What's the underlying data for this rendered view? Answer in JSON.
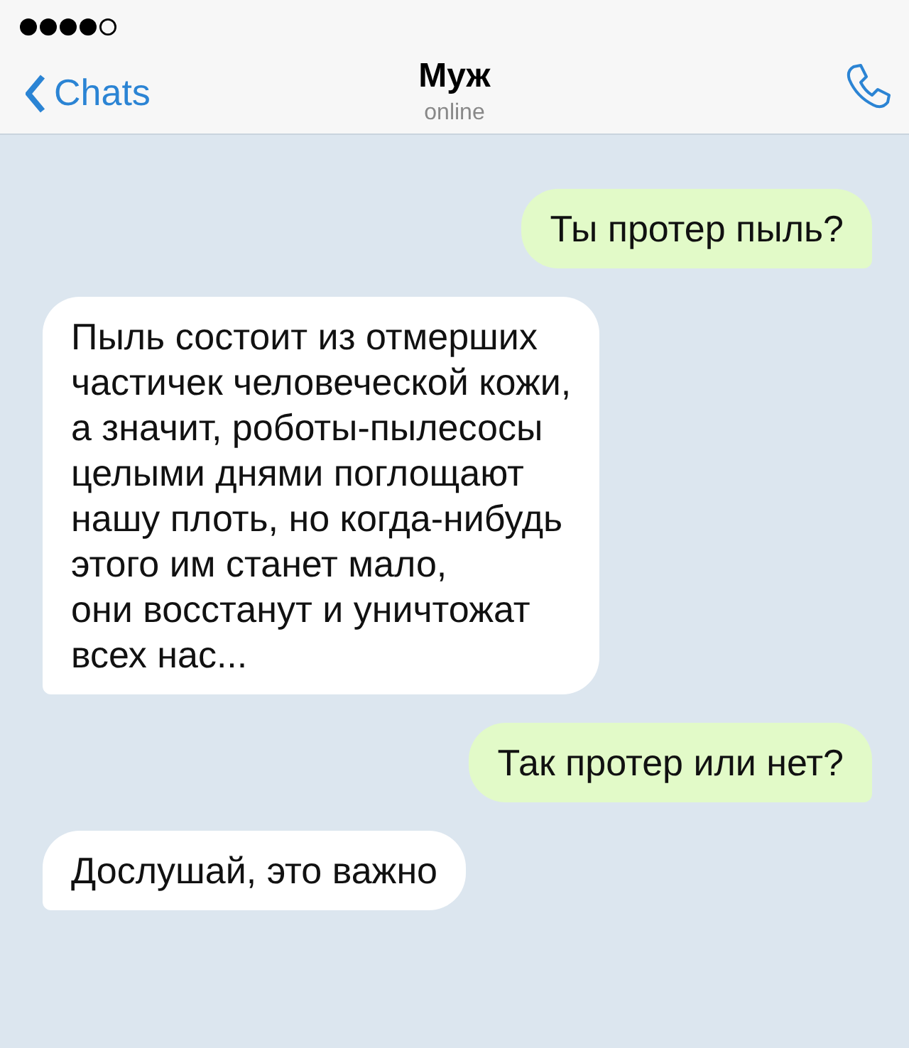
{
  "header": {
    "back": "Chats",
    "title": "Муж",
    "subtitle": "online"
  },
  "messages": [
    {
      "kind": "outgoing",
      "text": "Ты протер пыль?"
    },
    {
      "kind": "incoming",
      "text": "Пыль состоит из отмерших\nчастичек человеческой кожи,\nа значит, роботы-пылесосы\nцелыми днями поглощают\nнашу плоть, но когда-нибудь\nэтого им станет мало,\nони восстанут и уничтожат\nвсех нас..."
    },
    {
      "kind": "outgoing",
      "text": "Так протер или нет?"
    },
    {
      "kind": "incoming",
      "text": "Дослушай, это важно"
    }
  ]
}
